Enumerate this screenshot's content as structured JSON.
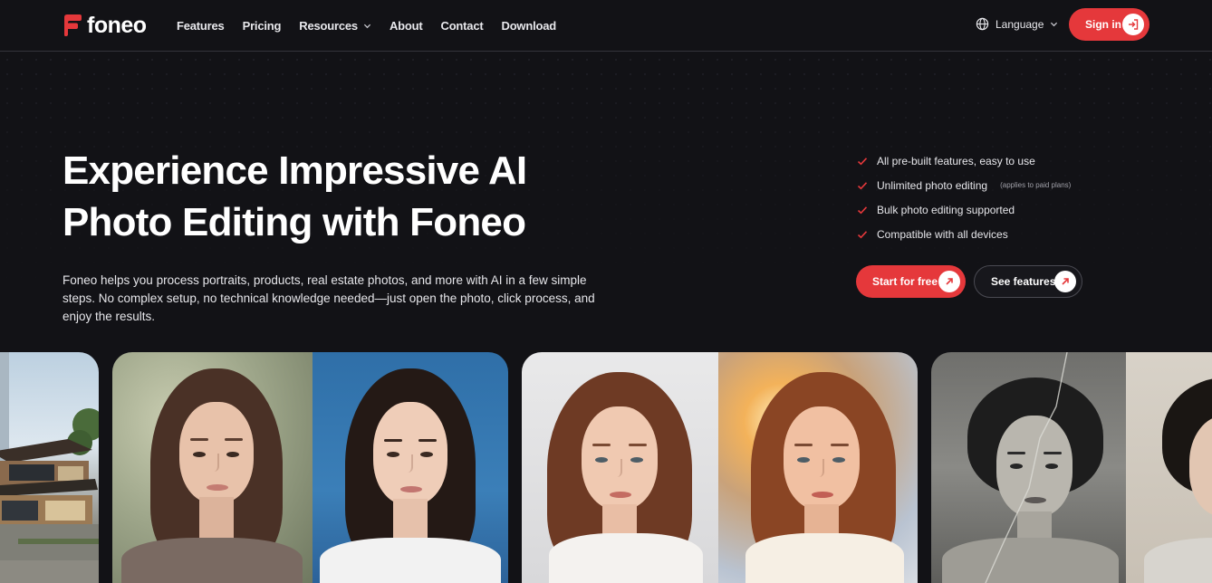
{
  "brand": {
    "name": "foneo",
    "accent": "#e5383b"
  },
  "nav": {
    "items": [
      {
        "label": "Features"
      },
      {
        "label": "Pricing"
      },
      {
        "label": "Resources",
        "icon": "chevron-down-icon"
      },
      {
        "label": "About"
      },
      {
        "label": "Contact"
      },
      {
        "label": "Download"
      }
    ]
  },
  "header": {
    "language_label": "Language",
    "language_icon": "globe-icon",
    "signin_label": "Sign in",
    "signin_icon": "sign-in-arrow-icon"
  },
  "hero": {
    "headline_line1": "Experience Impressive AI",
    "headline_line2": "Photo Editing with Foneo",
    "subtext": "Foneo helps you process portraits, products, real estate photos, and more with AI in a few simple steps. No complex setup, no technical knowledge needed—just open the photo, click process, and enjoy the results.",
    "features": [
      {
        "text": "All pre-built features, easy to use",
        "note": ""
      },
      {
        "text": "Unlimited photo editing",
        "note": "(applies to paid plans)"
      },
      {
        "text": "Bulk photo editing supported",
        "note": ""
      },
      {
        "text": "Compatible with all devices",
        "note": ""
      }
    ],
    "cta_primary": "Start for free",
    "cta_secondary": "See features",
    "cta_icon": "arrow-up-right-icon"
  },
  "gallery": {
    "cards": [
      {
        "name": "real-estate-photo",
        "description_icon": "house-image"
      },
      {
        "name": "portrait-background-change",
        "before": "outdoor",
        "after": "blue-studio"
      },
      {
        "name": "portrait-retouch",
        "before": "white-studio",
        "after": "sunset-backlight"
      },
      {
        "name": "photo-restoration",
        "before": "damaged-bw",
        "after": "restored"
      }
    ]
  }
}
